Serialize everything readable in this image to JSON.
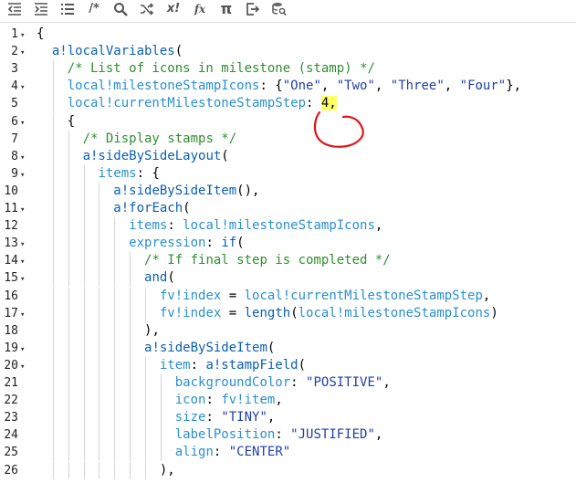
{
  "toolbar": {
    "items": [
      {
        "name": "outdent-icon"
      },
      {
        "name": "indent-icon"
      },
      {
        "name": "list-format-icon"
      },
      {
        "name": "comment-icon",
        "label": "/*"
      },
      {
        "name": "search-icon"
      },
      {
        "name": "shuffle-icon"
      },
      {
        "name": "not-icon",
        "label": "x!"
      },
      {
        "name": "function-icon",
        "label": "fx"
      },
      {
        "name": "pi-icon",
        "label": "π"
      },
      {
        "name": "export-icon"
      },
      {
        "name": "database-search-icon"
      }
    ]
  },
  "colors": {
    "function": "#0a5fb4",
    "variable": "#2a8fd1",
    "string": "#1f3fa8",
    "comment": "#2f8f2f",
    "highlight": "#ffff66",
    "annotation": "#e0141a"
  },
  "lines": [
    {
      "n": "1",
      "fold": "▾",
      "indent": 0,
      "tokens": [
        {
          "t": "{"
        }
      ]
    },
    {
      "n": "2",
      "fold": "▾",
      "indent": 1,
      "tokens": [
        {
          "t": "a!localVariables",
          "c": "fn"
        },
        {
          "t": "("
        }
      ]
    },
    {
      "n": "3",
      "fold": "",
      "indent": 2,
      "tokens": [
        {
          "t": "/* List of icons in milestone (stamp) */",
          "c": "cmt"
        }
      ]
    },
    {
      "n": "4",
      "fold": "▾",
      "indent": 2,
      "tokens": [
        {
          "t": "local!milestoneStampIcons",
          "c": "var"
        },
        {
          "t": ": {"
        },
        {
          "t": "\"One\"",
          "c": "str"
        },
        {
          "t": ", "
        },
        {
          "t": "\"Two\"",
          "c": "str"
        },
        {
          "t": ", "
        },
        {
          "t": "\"Three\"",
          "c": "str"
        },
        {
          "t": ", "
        },
        {
          "t": "\"Four\"",
          "c": "str"
        },
        {
          "t": "},"
        }
      ]
    },
    {
      "n": "5",
      "fold": "",
      "indent": 2,
      "tokens": [
        {
          "t": "local!currentMilestoneStampStep",
          "c": "var"
        },
        {
          "t": ": "
        },
        {
          "t": "4,",
          "c": "hl"
        }
      ]
    },
    {
      "n": "6",
      "fold": "▾",
      "indent": 2,
      "tokens": [
        {
          "t": "{"
        }
      ]
    },
    {
      "n": "7",
      "fold": "",
      "indent": 3,
      "tokens": [
        {
          "t": "/* Display stamps */",
          "c": "cmt"
        }
      ]
    },
    {
      "n": "8",
      "fold": "▾",
      "indent": 3,
      "tokens": [
        {
          "t": "a!sideBySideLayout",
          "c": "fn"
        },
        {
          "t": "("
        }
      ]
    },
    {
      "n": "9",
      "fold": "▾",
      "indent": 4,
      "tokens": [
        {
          "t": "items",
          "c": "var"
        },
        {
          "t": ": {"
        }
      ]
    },
    {
      "n": "10",
      "fold": "",
      "indent": 5,
      "tokens": [
        {
          "t": "a!sideBySideItem",
          "c": "fn"
        },
        {
          "t": "(),"
        }
      ]
    },
    {
      "n": "11",
      "fold": "▾",
      "indent": 5,
      "tokens": [
        {
          "t": "a!forEach",
          "c": "fn"
        },
        {
          "t": "("
        }
      ]
    },
    {
      "n": "12",
      "fold": "",
      "indent": 6,
      "tokens": [
        {
          "t": "items",
          "c": "var"
        },
        {
          "t": ": "
        },
        {
          "t": "local!milestoneStampIcons",
          "c": "var"
        },
        {
          "t": ","
        }
      ]
    },
    {
      "n": "13",
      "fold": "▾",
      "indent": 6,
      "tokens": [
        {
          "t": "expression",
          "c": "var"
        },
        {
          "t": ": "
        },
        {
          "t": "if",
          "c": "fn"
        },
        {
          "t": "("
        }
      ]
    },
    {
      "n": "14",
      "fold": "▾",
      "indent": 7,
      "tokens": [
        {
          "t": "/* If final step is completed */",
          "c": "cmt"
        }
      ]
    },
    {
      "n": "15",
      "fold": "▾",
      "indent": 7,
      "tokens": [
        {
          "t": "and",
          "c": "fn"
        },
        {
          "t": "("
        }
      ]
    },
    {
      "n": "16",
      "fold": "",
      "indent": 8,
      "tokens": [
        {
          "t": "fv!index",
          "c": "var"
        },
        {
          "t": " = "
        },
        {
          "t": "local!currentMilestoneStampStep",
          "c": "var"
        },
        {
          "t": ","
        }
      ]
    },
    {
      "n": "17",
      "fold": "▾",
      "indent": 8,
      "tokens": [
        {
          "t": "fv!index",
          "c": "var"
        },
        {
          "t": " = "
        },
        {
          "t": "length",
          "c": "fn"
        },
        {
          "t": "("
        },
        {
          "t": "local!milestoneStampIcons",
          "c": "var"
        },
        {
          "t": ")"
        }
      ]
    },
    {
      "n": "18",
      "fold": "",
      "indent": 7,
      "tokens": [
        {
          "t": "),"
        }
      ]
    },
    {
      "n": "19",
      "fold": "▾",
      "indent": 7,
      "tokens": [
        {
          "t": "a!sideBySideItem",
          "c": "fn"
        },
        {
          "t": "("
        }
      ]
    },
    {
      "n": "20",
      "fold": "▾",
      "indent": 8,
      "tokens": [
        {
          "t": "item",
          "c": "var"
        },
        {
          "t": ": "
        },
        {
          "t": "a!stampField",
          "c": "fn"
        },
        {
          "t": "("
        }
      ]
    },
    {
      "n": "21",
      "fold": "",
      "indent": 9,
      "tokens": [
        {
          "t": "backgroundColor",
          "c": "var"
        },
        {
          "t": ": "
        },
        {
          "t": "\"POSITIVE\"",
          "c": "str"
        },
        {
          "t": ","
        }
      ]
    },
    {
      "n": "22",
      "fold": "",
      "indent": 9,
      "tokens": [
        {
          "t": "icon",
          "c": "var"
        },
        {
          "t": ": "
        },
        {
          "t": "fv!item",
          "c": "var"
        },
        {
          "t": ","
        }
      ]
    },
    {
      "n": "23",
      "fold": "",
      "indent": 9,
      "tokens": [
        {
          "t": "size",
          "c": "var"
        },
        {
          "t": ": "
        },
        {
          "t": "\"TINY\"",
          "c": "str"
        },
        {
          "t": ","
        }
      ]
    },
    {
      "n": "24",
      "fold": "",
      "indent": 9,
      "tokens": [
        {
          "t": "labelPosition",
          "c": "var"
        },
        {
          "t": ": "
        },
        {
          "t": "\"JUSTIFIED\"",
          "c": "str"
        },
        {
          "t": ","
        }
      ]
    },
    {
      "n": "25",
      "fold": "",
      "indent": 9,
      "tokens": [
        {
          "t": "align",
          "c": "var"
        },
        {
          "t": ": "
        },
        {
          "t": "\"CENTER\"",
          "c": "str"
        }
      ]
    },
    {
      "n": "26",
      "fold": "",
      "indent": 8,
      "tokens": [
        {
          "t": "),"
        }
      ]
    }
  ]
}
